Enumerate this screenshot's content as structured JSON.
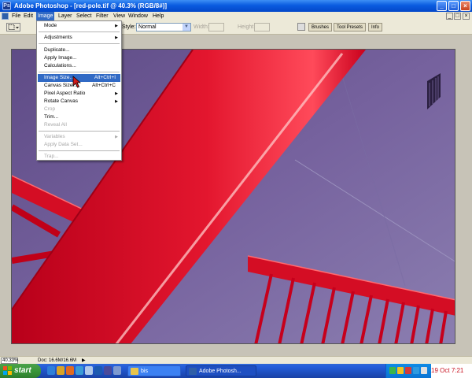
{
  "window": {
    "title": "Adobe Photoshop - [red-pole.tif @ 40.3% (RGB/8#)]",
    "icon_label": "Ps"
  },
  "window_controls": {
    "minimize": "_",
    "maximize": "□",
    "close": "×"
  },
  "menubar": {
    "items": [
      "File",
      "Edit",
      "Image",
      "Layer",
      "Select",
      "Filter",
      "View",
      "Window",
      "Help"
    ],
    "active": "Image"
  },
  "options": {
    "style_label": "Style:",
    "style_value": "Normal",
    "width_label": "Width:",
    "height_label": "Height:",
    "palette_tabs": [
      "Brushes",
      "Tool Presets",
      "Info"
    ]
  },
  "image_menu": {
    "items": [
      {
        "label": "Mode",
        "submenu": true
      },
      {
        "label": "Adjustments",
        "submenu": true
      },
      {
        "label": "Duplicate..."
      },
      {
        "label": "Apply Image..."
      },
      {
        "label": "Calculations..."
      },
      {
        "label": "Image Size...",
        "shortcut": "Alt+Ctrl+I",
        "highlighted": true
      },
      {
        "label": "Canvas Size...",
        "shortcut": "Alt+Ctrl+C"
      },
      {
        "label": "Pixel Aspect Ratio",
        "submenu": true
      },
      {
        "label": "Rotate Canvas",
        "submenu": true
      },
      {
        "label": "Crop",
        "disabled": true
      },
      {
        "label": "Trim..."
      },
      {
        "label": "Reveal All",
        "disabled": true
      },
      {
        "label": "Variables",
        "submenu": true,
        "disabled": true
      },
      {
        "label": "Apply Data Set...",
        "disabled": true
      },
      {
        "label": "Trap...",
        "disabled": true
      }
    ]
  },
  "status": {
    "zoom": "40.33%",
    "doc_info": "Doc: 16.6M/16.6M"
  },
  "taskbar": {
    "start_label": "start",
    "tasks": [
      {
        "label": "bis",
        "state": "normal"
      },
      {
        "label": "Adobe Photosh...",
        "state": "pressed"
      }
    ],
    "clock_date": "19 Oct",
    "clock_time": "7:21"
  },
  "colors": {
    "title_bar": "#0a5ce0",
    "menu_highlight": "#316ac5",
    "pole_red": "#e0102a",
    "wall_purple": "#6f5a96"
  }
}
